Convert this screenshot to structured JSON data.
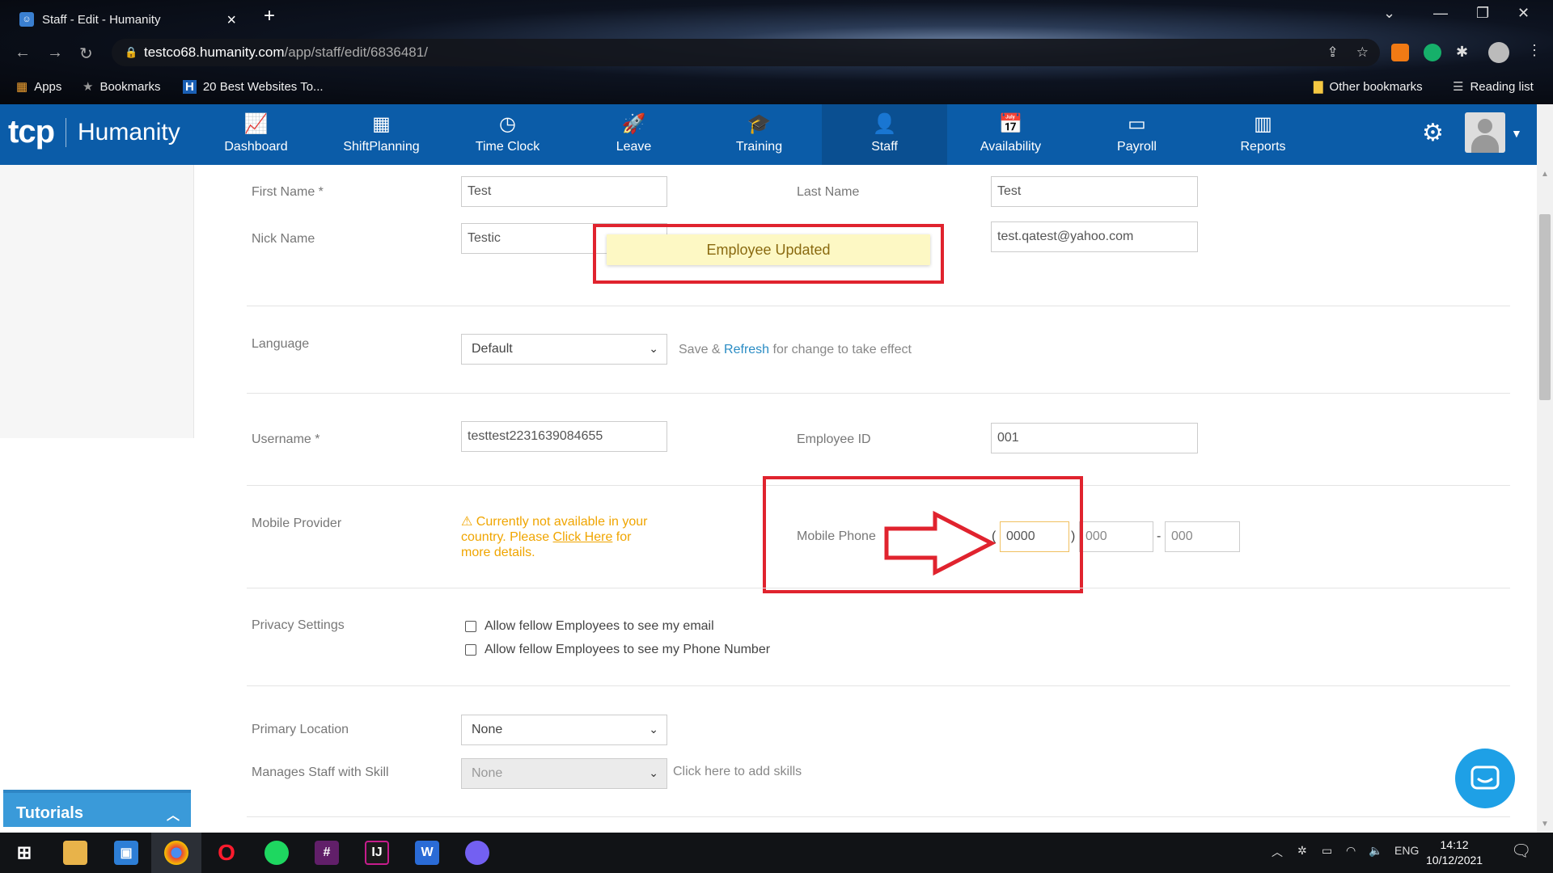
{
  "browser": {
    "tab_title": "Staff - Edit - Humanity",
    "url_host": "testco68.humanity.com",
    "url_path": "/app/staff/edit/6836481/",
    "bookmarks": [
      "Apps",
      "Bookmarks",
      "20 Best Websites To...",
      "Other bookmarks",
      "Reading list"
    ]
  },
  "header": {
    "logo_tcp": "tcp",
    "logo_name": "Humanity",
    "nav": [
      {
        "label": "Dashboard",
        "icon": "dashboard-icon"
      },
      {
        "label": "ShiftPlanning",
        "icon": "calendar-grid-icon"
      },
      {
        "label": "Time Clock",
        "icon": "stopwatch-icon"
      },
      {
        "label": "Leave",
        "icon": "rocket-icon"
      },
      {
        "label": "Training",
        "icon": "graduation-cap-icon"
      },
      {
        "label": "Staff",
        "icon": "person-icon"
      },
      {
        "label": "Availability",
        "icon": "calendar-check-icon"
      },
      {
        "label": "Payroll",
        "icon": "wallet-icon"
      },
      {
        "label": "Reports",
        "icon": "bar-chart-icon"
      }
    ],
    "active_nav": "Staff"
  },
  "form": {
    "first_name_label": "First Name *",
    "first_name_value": "Test",
    "last_name_label": "Last Name",
    "last_name_value": "Test",
    "nick_name_label": "Nick Name",
    "nick_name_value": "Testic",
    "email_value": "test.qatest@yahoo.com",
    "language_label": "Language",
    "language_value": "Default",
    "language_hint_save": "Save &",
    "language_hint_refresh": "Refresh",
    "language_hint_rest": "for change to take effect",
    "username_label": "Username *",
    "username_value": "testtest2231639084655",
    "employee_id_label": "Employee ID",
    "employee_id_value": "001",
    "mobile_provider_label": "Mobile Provider",
    "mobile_provider_warning_1": "Currently not available in your country. Please",
    "mobile_provider_warning_link": "Click Here",
    "mobile_provider_warning_2": "for more details.",
    "mobile_phone_label": "Mobile Phone",
    "phone_area": "0000",
    "phone_prefix_placeholder": "000",
    "phone_line_placeholder": "000",
    "privacy_label": "Privacy Settings",
    "privacy_email": "Allow fellow Employees to see my email",
    "privacy_phone": "Allow fellow Employees to see my Phone Number",
    "primary_location_label": "Primary Location",
    "primary_location_value": "None",
    "manages_skill_label": "Manages Staff with Skill",
    "manages_skill_value": "None",
    "add_skills_link": "Click here to add skills"
  },
  "toast": {
    "message": "Employee Updated"
  },
  "tutorials": {
    "label": "Tutorials"
  },
  "taskbar": {
    "language": "ENG",
    "time": "14:12",
    "date": "10/12/2021"
  },
  "colors": {
    "brand_blue": "#0b5ca8",
    "highlight_red": "#e0232e",
    "toast_bg": "#fdf8c4",
    "warning_orange": "#f0a500"
  }
}
